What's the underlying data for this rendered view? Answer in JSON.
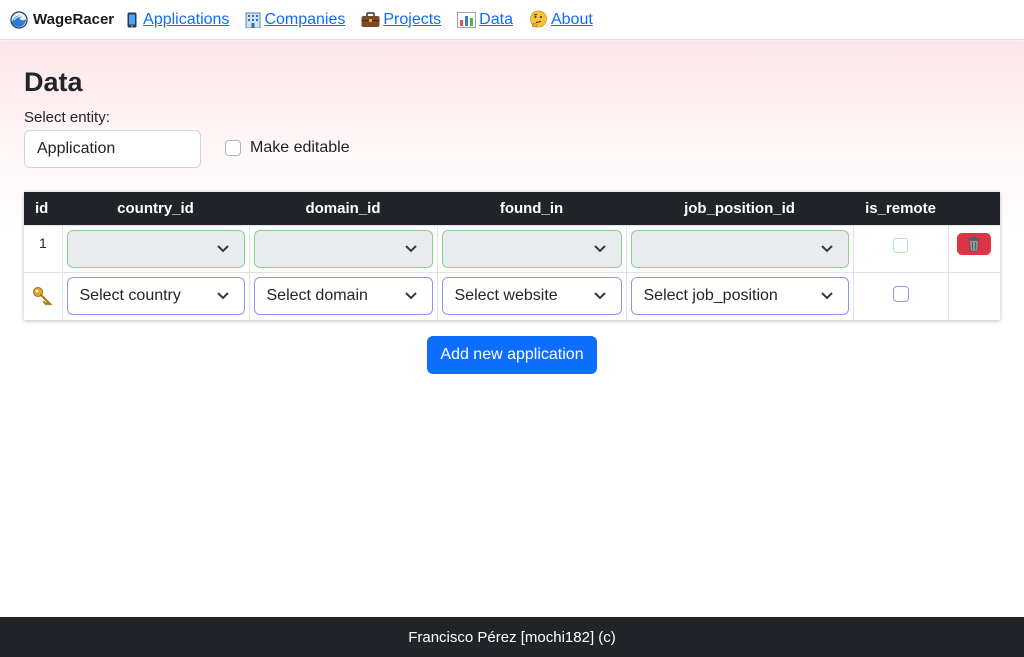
{
  "navbar": {
    "brand": {
      "label": "WageRacer",
      "icon": "wave-icon"
    },
    "links": [
      {
        "label": "Applications",
        "icon": "mobile-phone-icon"
      },
      {
        "label": "Companies",
        "icon": "office-building-icon"
      },
      {
        "label": "Projects",
        "icon": "briefcase-icon"
      },
      {
        "label": "Data",
        "icon": "bar-chart-icon"
      },
      {
        "label": "About",
        "icon": "thinking-face-icon"
      }
    ]
  },
  "page": {
    "title": "Data",
    "entity_label": "Select entity:",
    "entity_value": "Application",
    "editable_label": "Make editable",
    "editable_checked": false
  },
  "table": {
    "columns": [
      "id",
      "country_id",
      "domain_id",
      "found_in",
      "job_position_id",
      "is_remote",
      ""
    ],
    "rows": [
      {
        "id": "1",
        "country_id": "",
        "domain_id": "",
        "found_in": "",
        "job_position_id": "",
        "is_remote": false,
        "action_icon": "trash-icon"
      }
    ],
    "new_row": {
      "icon": "key-icon",
      "country_placeholder": "Select country",
      "domain_placeholder": "Select domain",
      "website_placeholder": "Select website",
      "job_position_placeholder": "Select job_position",
      "is_remote": false
    }
  },
  "add_button": "Add new application",
  "footer": "Francisco Pérez [mochi182] (c)",
  "colors": {
    "primary": "#0d6efd",
    "danger": "#dc3545",
    "dark": "#212529",
    "valid_border": "#86d38e",
    "focus_border": "#8e95f5"
  }
}
